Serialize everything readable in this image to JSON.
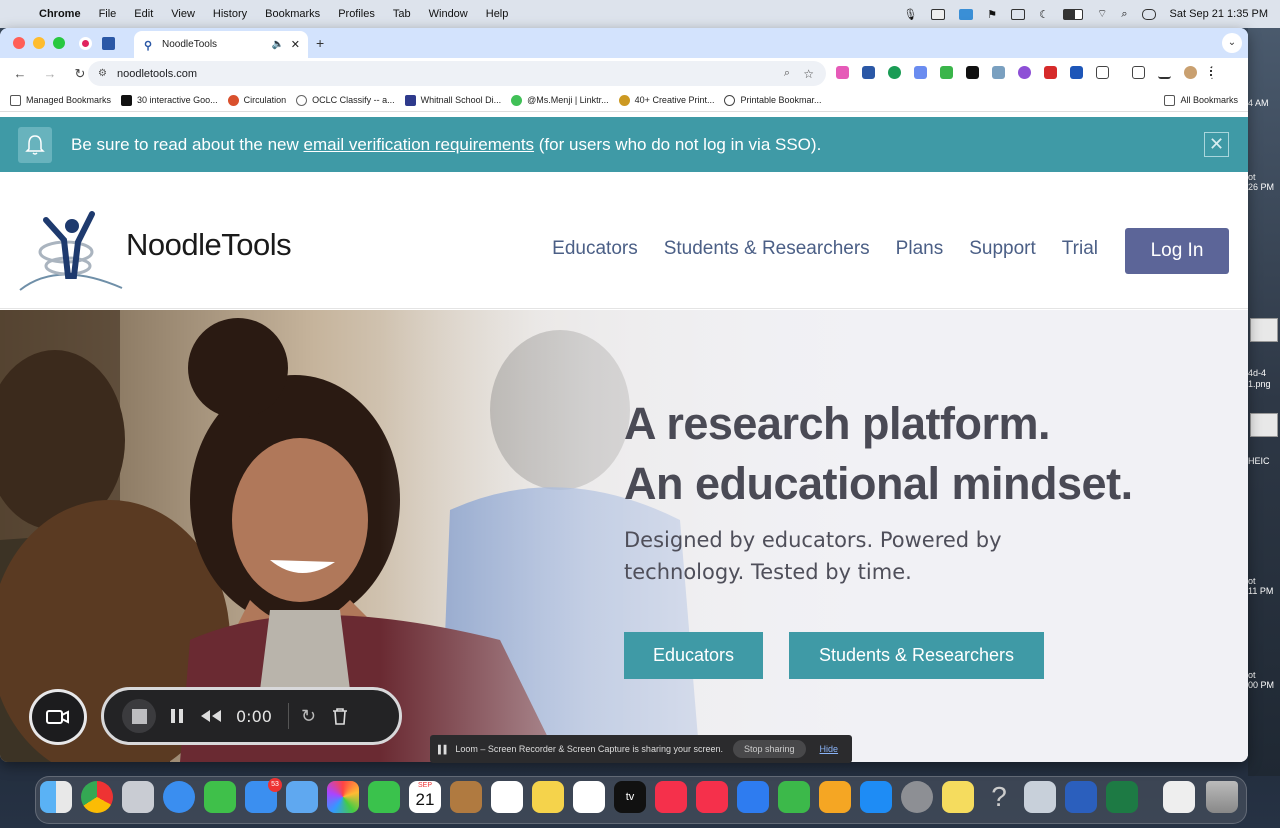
{
  "menubar": {
    "app": "Chrome",
    "items": [
      "File",
      "Edit",
      "View",
      "History",
      "Bookmarks",
      "Profiles",
      "Tab",
      "Window",
      "Help"
    ],
    "datetime": "Sat Sep 21  1:35 PM"
  },
  "browser": {
    "tab_title": "NoodleTools",
    "url": "noodletools.com",
    "bookmarks": [
      "Managed Bookmarks",
      "30 interactive Goo...",
      "Circulation",
      "OCLC Classify -- a...",
      "Whitnall School Di...",
      "@Ms.Menji | Linktr...",
      "40+ Creative Print...",
      "Printable Bookmar..."
    ],
    "all_bookmarks": "All Bookmarks"
  },
  "notice": {
    "text_before": "Be sure to read about the new ",
    "link": "email verification requirements",
    "text_after": " (for users who do not log in via SSO).",
    "close": "✕"
  },
  "header": {
    "logo_text": "NoodleTools",
    "nav": [
      "Educators",
      "Students & Researchers",
      "Plans",
      "Support",
      "Trial"
    ],
    "login": "Log In"
  },
  "hero": {
    "headline_1": "A research platform.",
    "headline_2": "An educational mindset.",
    "subtext_1": "Designed by educators. Powered by",
    "subtext_2": "technology. Tested by time.",
    "cta_educators": "Educators",
    "cta_students": "Students & Researchers"
  },
  "loom": {
    "time": "0:00",
    "share_text": "Loom – Screen Recorder & Screen Capture is sharing your screen.",
    "stop_sharing": "Stop sharing",
    "hide": "Hide"
  },
  "dock": {
    "mail_badge": "53",
    "calendar_month": "SEP",
    "calendar_day": "21",
    "tv_label": "tv"
  },
  "desktop": {
    "labels": [
      "ot",
      "26 PM",
      "4d-4",
      "1.png",
      "HEIC",
      "ot",
      "11 PM",
      "ot",
      "00 PM"
    ],
    "right_text": "4 AM"
  }
}
